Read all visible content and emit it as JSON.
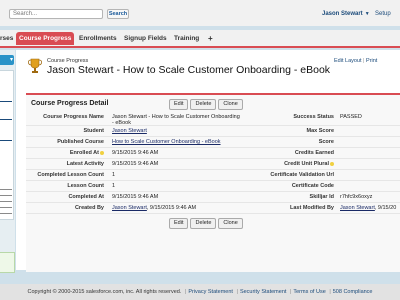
{
  "header": {
    "search_placeholder": "Search...",
    "search_button": "Search",
    "user_name": "Jason Stewart",
    "setup_link": "Setup"
  },
  "tabs": [
    {
      "label": "rses",
      "active": false
    },
    {
      "label": "Course Progress",
      "active": true
    },
    {
      "label": "Enrollments",
      "active": false
    },
    {
      "label": "Signup Fields",
      "active": false
    },
    {
      "label": "Training",
      "active": false
    },
    {
      "label": "+",
      "active": false
    }
  ],
  "record": {
    "breadcrumb": "Course Progress",
    "title": "Jason Stewart - How to Scale Customer Onboarding - eBook",
    "edit_layout": "Edit Layout",
    "print": "Print"
  },
  "detail": {
    "section_title": "Course Progress Detail",
    "buttons": {
      "edit": "Edit",
      "delete": "Delete",
      "clone": "Clone"
    },
    "left_fields": [
      {
        "label": "Course Progress Name",
        "value": "Jason Stewart - How to Scale Customer Onboarding",
        "value2": "- eBook",
        "link": false,
        "info": false
      },
      {
        "label": "Student",
        "value": "Jason Stewart",
        "link": true,
        "info": false
      },
      {
        "label": "Published Course",
        "value": "How to Scale Customer Onboarding - eBook",
        "link": true,
        "info": false
      },
      {
        "label": "Enrolled At",
        "value": "9/15/2015 9:46 AM",
        "link": false,
        "info": true
      },
      {
        "label": "Latest Activity",
        "value": "9/15/2015 9:46 AM",
        "link": false,
        "info": false
      },
      {
        "label": "Completed Lesson Count",
        "value": "1",
        "link": false,
        "info": false
      },
      {
        "label": "Lesson Count",
        "value": "1",
        "link": false,
        "info": false
      },
      {
        "label": "Completed At",
        "value": "9/15/2015 9:46 AM",
        "link": false,
        "info": false
      },
      {
        "label": "Created By",
        "value": "Jason Stewart",
        "suffix": ", 9/15/2015 9:46 AM",
        "link": true,
        "info": false
      }
    ],
    "right_fields": [
      {
        "label": "Success Status",
        "value": "PASSED",
        "info": false
      },
      {
        "label": "Max Score",
        "value": "",
        "info": false
      },
      {
        "label": "Score",
        "value": "",
        "info": false
      },
      {
        "label": "Credits Earned",
        "value": "",
        "info": false
      },
      {
        "label": "Credit Unit Plural",
        "value": "",
        "info": true
      },
      {
        "label": "Certificate Validation Url",
        "value": "",
        "info": false
      },
      {
        "label": "Certificate Code",
        "value": "",
        "info": false
      },
      {
        "label": "Skilljar Id",
        "value": "r7hfc9x6oxyz",
        "info": false
      },
      {
        "label": "Last Modified By",
        "value": "Jason Stewart",
        "suffix": ", 9/15/20",
        "link": true,
        "info": false
      }
    ]
  },
  "footer": {
    "copyright": "Copyright © 2000-2015 salesforce.com, inc. All rights reserved.",
    "links": [
      "Privacy Statement",
      "Security Statement",
      "Terms of Use",
      "508 Compliance"
    ]
  }
}
